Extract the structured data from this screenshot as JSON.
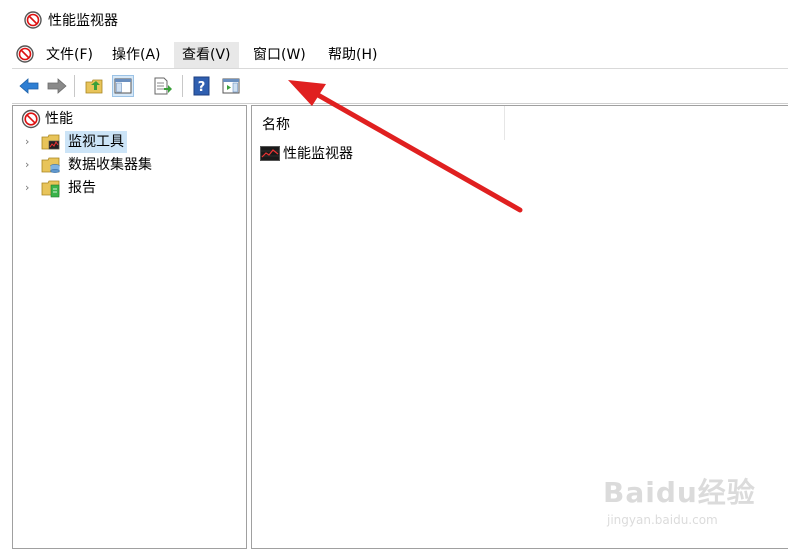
{
  "window": {
    "title": "性能监视器"
  },
  "menu": {
    "items": [
      {
        "label": "文件(F)"
      },
      {
        "label": "操作(A)"
      },
      {
        "label": "查看(V)"
      },
      {
        "label": "窗口(W)"
      },
      {
        "label": "帮助(H)"
      }
    ]
  },
  "toolbar": {
    "buttons": [
      {
        "icon": "back-arrow-icon",
        "color": "#2f7fd3"
      },
      {
        "icon": "forward-arrow-icon",
        "color": "#7a7a7a"
      },
      {
        "icon": "up-folder-icon"
      },
      {
        "icon": "show-hide-console-tree-icon"
      },
      {
        "icon": "export-list-icon"
      },
      {
        "icon": "help-icon"
      },
      {
        "icon": "show-hide-action-pane-icon"
      }
    ]
  },
  "tree": {
    "root": {
      "label": "性能"
    },
    "children": [
      {
        "label": "监视工具",
        "selected": true
      },
      {
        "label": "数据收集器集"
      },
      {
        "label": "报告"
      }
    ]
  },
  "list": {
    "column_name": "名称",
    "items": [
      {
        "label": "性能监视器"
      }
    ]
  },
  "annotation": {
    "arrow_color": "#e02020"
  },
  "watermark": {
    "brand": "Baidu经验",
    "url": "jingyan.baidu.com"
  }
}
